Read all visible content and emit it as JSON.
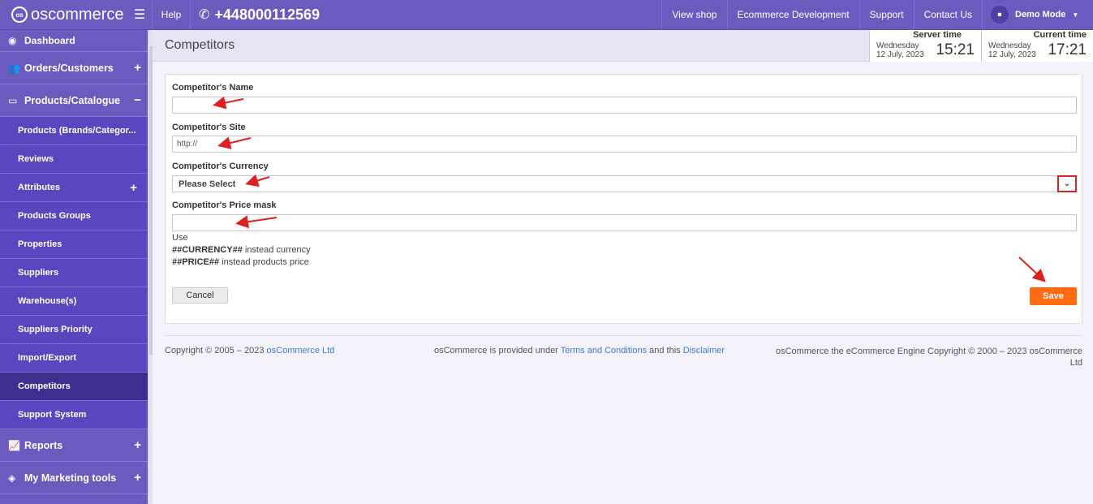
{
  "topbar": {
    "logo_text": "oscommerce",
    "help": "Help",
    "phone": "+448000112569",
    "links": [
      "View shop",
      "Ecommerce Development",
      "Support",
      "Contact Us"
    ],
    "user": "Demo Mode"
  },
  "sidebar": {
    "dashboard": "Dashboard",
    "orders": "Orders/Customers",
    "products": "Products/Catalogue",
    "sub": [
      "Products (Brands/Categor...",
      "Reviews",
      "Attributes",
      "Products Groups",
      "Properties",
      "Suppliers",
      "Warehouse(s)",
      "Suppliers Priority",
      "Import/Export",
      "Competitors",
      "Support System"
    ],
    "reports": "Reports",
    "marketing": "My Marketing tools",
    "active": "Competitors"
  },
  "header": {
    "title": "Competitors",
    "server_time": {
      "label": "Server time",
      "day": "Wednesday",
      "date": "12 July, 2023",
      "clock": "15:21"
    },
    "current_time": {
      "label": "Current time",
      "day": "Wednesday",
      "date": "12 July, 2023",
      "clock": "17:21"
    }
  },
  "form": {
    "name_label": "Competitor's Name",
    "name_value": "",
    "site_label": "Competitor's Site",
    "site_value": "http://",
    "currency_label": "Competitor's Currency",
    "currency_value": "Please Select",
    "mask_label": "Competitor's Price mask",
    "mask_value": "",
    "hint_use": "Use",
    "hint_currency_code": "##CURRENCY##",
    "hint_currency_text": " instead currency",
    "hint_price_code": "##PRICE##",
    "hint_price_text": " instead products price",
    "cancel": "Cancel",
    "save": "Save"
  },
  "footer": {
    "copyright_pre": "Copyright © 2005 – 2023 ",
    "copyright_link": "osCommerce Ltd",
    "mid_pre": "osCommerce is provided under ",
    "mid_terms": "Terms and Conditions",
    "mid_and": " and this ",
    "mid_disclaimer": "Disclaimer",
    "right": "osCommerce the eCommerce Engine Copyright © 2000 – 2023 osCommerce Ltd"
  },
  "colors": {
    "brand": "#6b5bbf",
    "sub_menu": "#5a47c0",
    "active_menu": "#3e2f8f",
    "save_button": "#ff6a13",
    "annotation": "#e02020",
    "link": "#3c7ad6"
  }
}
